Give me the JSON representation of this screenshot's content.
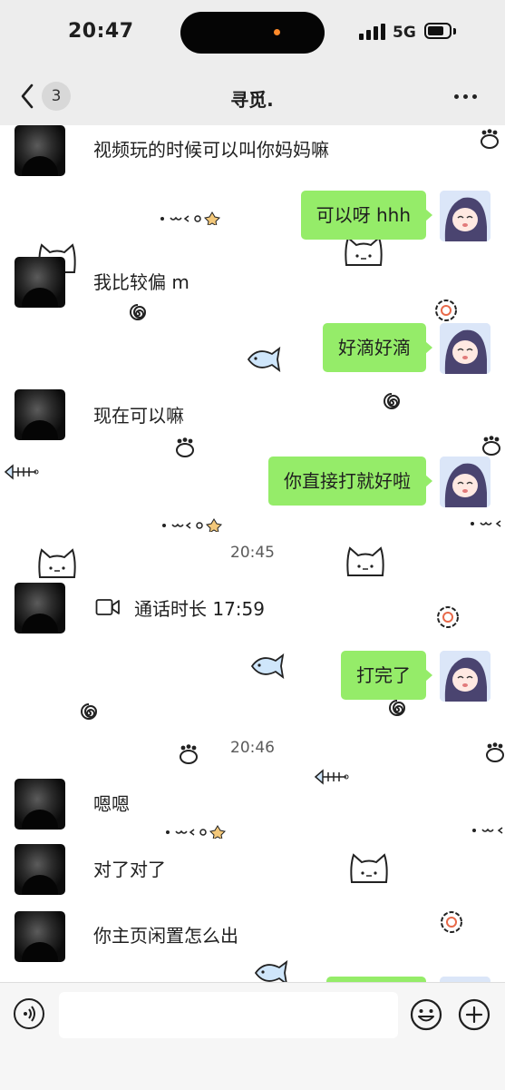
{
  "status_bar": {
    "time": "20:47",
    "network": "5G"
  },
  "nav": {
    "unread_count": "3",
    "title": "寻觅."
  },
  "messages": {
    "m1": "视频玩的时候可以叫你妈妈嘛",
    "m2": "可以呀 hhh",
    "m3": "我比较偏 m",
    "m4": "好滴好滴",
    "m5": "现在可以嘛",
    "m6": "你直接打就好啦",
    "time1": "20:45",
    "call": "通话时长 17:59",
    "m7": "打完了",
    "time2": "20:46",
    "m8": "嗯嗯",
    "m9": "对了对了",
    "m10": "你主页闲置怎么出"
  },
  "input": {
    "placeholder": ""
  },
  "colors": {
    "self_bubble": "#95ec69",
    "bar_bg": "#ededed"
  },
  "icons": [
    "chevron-left-icon",
    "more-icon",
    "video-call-icon",
    "voice-icon",
    "emoji-icon",
    "plus-icon",
    "cat-sticker-icon",
    "fish-sticker-icon",
    "spiral-icon"
  ]
}
